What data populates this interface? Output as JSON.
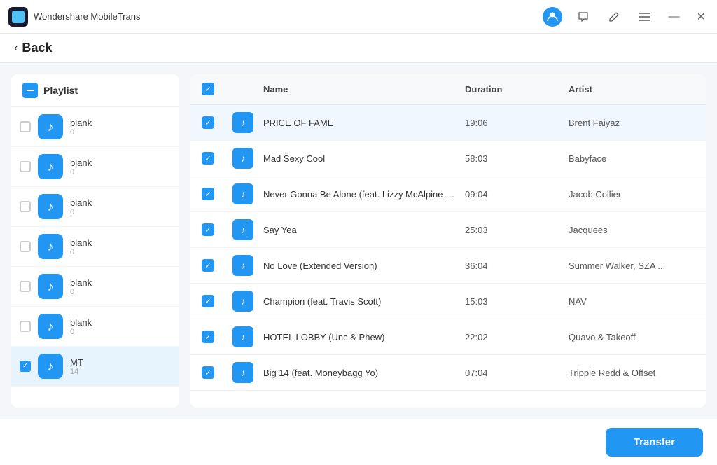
{
  "app": {
    "title": "Wondershare MobileTrans",
    "back_label": "Back"
  },
  "titlebar_buttons": {
    "avatar_icon": "👤",
    "chat_icon": "💬",
    "edit_icon": "✏",
    "menu_icon": "☰",
    "minimize_icon": "—",
    "close_icon": "✕"
  },
  "sidebar": {
    "header_label": "Playlist",
    "items": [
      {
        "name": "blank",
        "count": "0",
        "checked": false
      },
      {
        "name": "blank",
        "count": "0",
        "checked": false
      },
      {
        "name": "blank",
        "count": "0",
        "checked": false
      },
      {
        "name": "blank",
        "count": "0",
        "checked": false
      },
      {
        "name": "blank",
        "count": "0",
        "checked": false
      },
      {
        "name": "blank",
        "count": "0",
        "checked": false
      },
      {
        "name": "MT",
        "count": "14",
        "checked": true,
        "selected": true
      }
    ]
  },
  "track_table": {
    "columns": {
      "name": "Name",
      "duration": "Duration",
      "artist": "Artist"
    },
    "rows": [
      {
        "name": "PRICE OF FAME",
        "duration": "19:06",
        "artist": "Brent Faiyaz",
        "checked": true
      },
      {
        "name": "Mad Sexy Cool",
        "duration": "58:03",
        "artist": "Babyface",
        "checked": true
      },
      {
        "name": "Never Gonna Be Alone (feat. Lizzy McAlpine & J...",
        "duration": "09:04",
        "artist": "Jacob Collier",
        "checked": true
      },
      {
        "name": "Say Yea",
        "duration": "25:03",
        "artist": "Jacquees",
        "checked": true
      },
      {
        "name": "No Love (Extended Version)",
        "duration": "36:04",
        "artist": "Summer Walker, SZA ...",
        "checked": true
      },
      {
        "name": "Champion (feat. Travis Scott)",
        "duration": "15:03",
        "artist": "NAV",
        "checked": true
      },
      {
        "name": "HOTEL LOBBY (Unc & Phew)",
        "duration": "22:02",
        "artist": "Quavo & Takeoff",
        "checked": true
      },
      {
        "name": "Big 14 (feat. Moneybagg Yo)",
        "duration": "07:04",
        "artist": "Trippie Redd & Offset",
        "checked": true
      }
    ]
  },
  "footer": {
    "transfer_label": "Transfer"
  }
}
